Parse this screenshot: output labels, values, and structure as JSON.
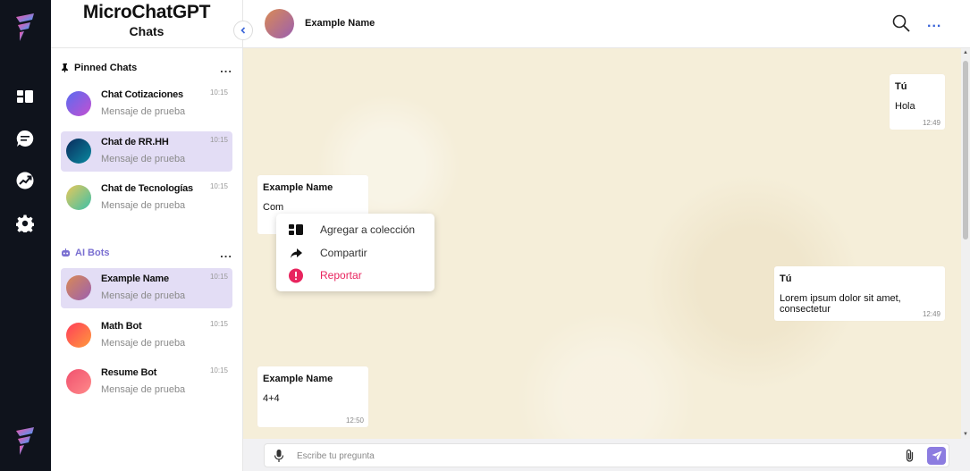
{
  "app": {
    "title": "MicroChatGPT",
    "subtitle": "Chats"
  },
  "colors": {
    "rail": "#0f131c",
    "accent": "#8c7ce0",
    "active_item": "#e3ddf5",
    "danger": "#e8245e",
    "chat_bg": "#f5eed9"
  },
  "rail": {
    "icons": [
      "logo-icon",
      "dashboard-icon",
      "chat-icon",
      "trending-icon",
      "gear-icon",
      "logo-icon"
    ]
  },
  "sidebar": {
    "pinned": {
      "title": "Pinned Chats",
      "more": "...",
      "items": [
        {
          "name": "Chat Cotizaciones",
          "message": "Mensaje de prueba",
          "time": "10:15",
          "active": false
        },
        {
          "name": "Chat de RR.HH",
          "message": "Mensaje de prueba",
          "time": "10:15",
          "active": true
        },
        {
          "name": "Chat de Tecnologías",
          "message": "Mensaje de prueba",
          "time": "10:15",
          "active": false
        }
      ]
    },
    "bots": {
      "title": "AI Bots",
      "more": "...",
      "items": [
        {
          "name": "Example Name",
          "message": "Mensaje de prueba",
          "time": "10:15",
          "active": true
        },
        {
          "name": "Math Bot",
          "message": "Mensaje de prueba",
          "time": "10:15",
          "active": false
        },
        {
          "name": "Resume Bot",
          "message": "Mensaje de prueba",
          "time": "10:15",
          "active": false
        }
      ]
    }
  },
  "header": {
    "name": "Example Name",
    "more": "..."
  },
  "messages": [
    {
      "author": "Tú",
      "text": "Hola",
      "time": "12:49"
    },
    {
      "author": "Example Name",
      "text": "Com",
      "time": ""
    },
    {
      "author": "Tú",
      "text": "Lorem ipsum dolor sit amet, consectetur",
      "time": "12:49"
    },
    {
      "author": "Example Name",
      "text": "4+4",
      "time": "12:50"
    }
  ],
  "context_menu": {
    "items": [
      {
        "label": "Agregar a colección",
        "icon": "collection-icon"
      },
      {
        "label": "Compartir",
        "icon": "share-icon"
      },
      {
        "label": "Reportar",
        "icon": "report-icon"
      }
    ]
  },
  "input": {
    "placeholder": "Escribe tu pregunta",
    "value": ""
  }
}
